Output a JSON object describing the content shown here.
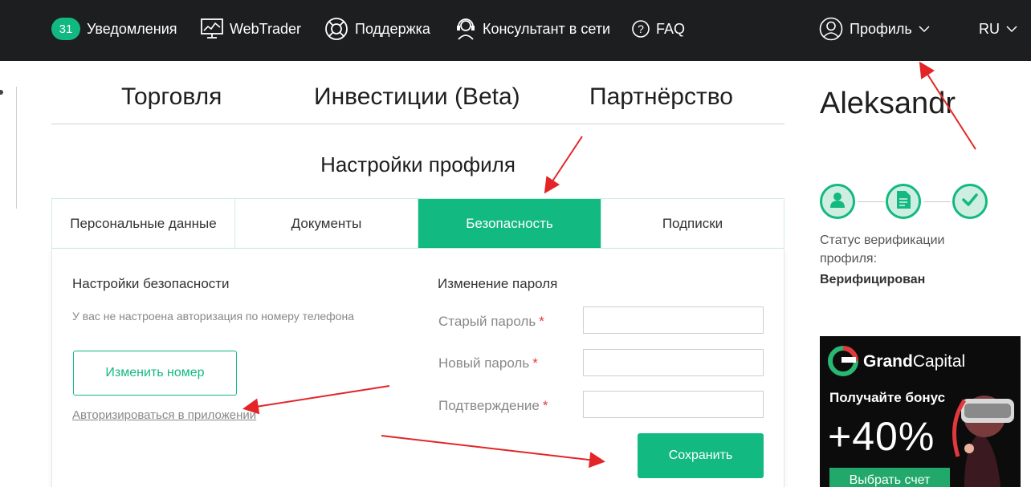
{
  "nav": {
    "notifications": {
      "count": "31",
      "label": "Уведомления"
    },
    "webtrader": "WebTrader",
    "support": "Поддержка",
    "consultant": "Консультант в сети",
    "faq": "FAQ",
    "profile": "Профиль",
    "language": "RU"
  },
  "main_tabs": [
    "Торговля",
    "Инвестиции (Beta)",
    "Партнёрство"
  ],
  "section_title": "Настройки профиля",
  "sub_tabs": [
    "Персональные данные",
    "Документы",
    "Безопасность",
    "Подписки"
  ],
  "active_sub_tab": "Безопасность",
  "security": {
    "title": "Настройки безопасности",
    "note": "У вас не настроена авторизация по номеру телефона",
    "change_number": "Изменить номер",
    "app_auth_link": "Авторизироваться в приложении"
  },
  "password": {
    "title": "Изменение пароля",
    "fields": [
      {
        "label": "Старый пароль",
        "value": ""
      },
      {
        "label": "Новый пароль",
        "value": ""
      },
      {
        "label": "Подтверждение",
        "value": ""
      }
    ],
    "required_mark": "*",
    "save": "Сохранить"
  },
  "user": {
    "name": "Aleksandr",
    "verification_label": "Статус верификации профиля:",
    "verification_status": "Верифицирован"
  },
  "ad": {
    "brand_bold": "Grand",
    "brand_rest": "Capital",
    "headline": "Получайте бонус",
    "bonus": "+40%",
    "cta": "Выбрать счет"
  },
  "colors": {
    "topbar": "#1d1e20",
    "accent": "#12b981",
    "required": "#e53935",
    "annotation": "#e32528"
  },
  "icons": {
    "webtrader": "monitor-chart-icon",
    "support": "lifebuoy-icon",
    "consultant": "headset-icon",
    "faq": "question-circle-icon",
    "profile": "user-circle-icon",
    "dropdown": "chevron-down-icon",
    "verification_steps": [
      "user-icon",
      "document-icon",
      "check-icon"
    ]
  }
}
